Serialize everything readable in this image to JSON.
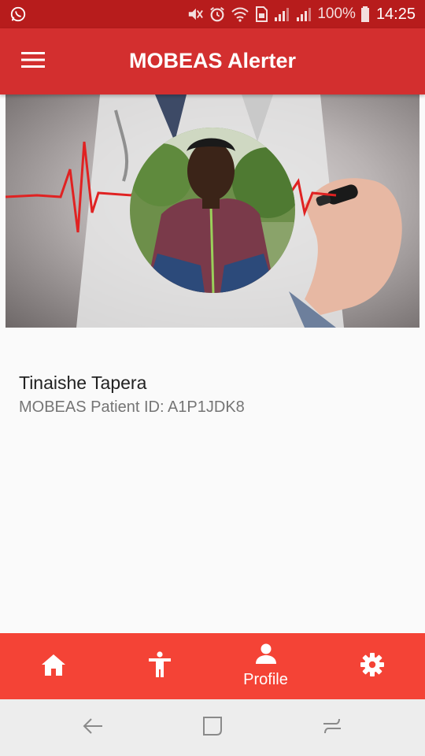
{
  "status_bar": {
    "battery_text": "100%",
    "time": "14:25",
    "icons": [
      "whatsapp-icon",
      "mute-icon",
      "alarm-icon",
      "wifi-icon",
      "sim-icon",
      "signal-icon",
      "signal-icon",
      "battery-icon"
    ]
  },
  "app_bar": {
    "title": "MOBEAS Alerter",
    "menu_icon": "menu-icon"
  },
  "profile": {
    "name": "Tinaishe Tapera",
    "patient_id": "MOBEAS Patient ID: A1P1JDK8"
  },
  "bottom_nav": {
    "items": [
      {
        "icon": "home-icon",
        "label": ""
      },
      {
        "icon": "accessibility-icon",
        "label": ""
      },
      {
        "icon": "person-icon",
        "label": "Profile",
        "selected": true
      },
      {
        "icon": "settings-icon",
        "label": ""
      }
    ]
  },
  "system_nav": {
    "buttons": [
      "back-icon",
      "recents-icon",
      "overview-icon"
    ]
  },
  "colors": {
    "status_bar": "#b71c1c",
    "app_bar": "#d32f2f",
    "bottom_nav": "#f44336",
    "background": "#fafafa"
  }
}
